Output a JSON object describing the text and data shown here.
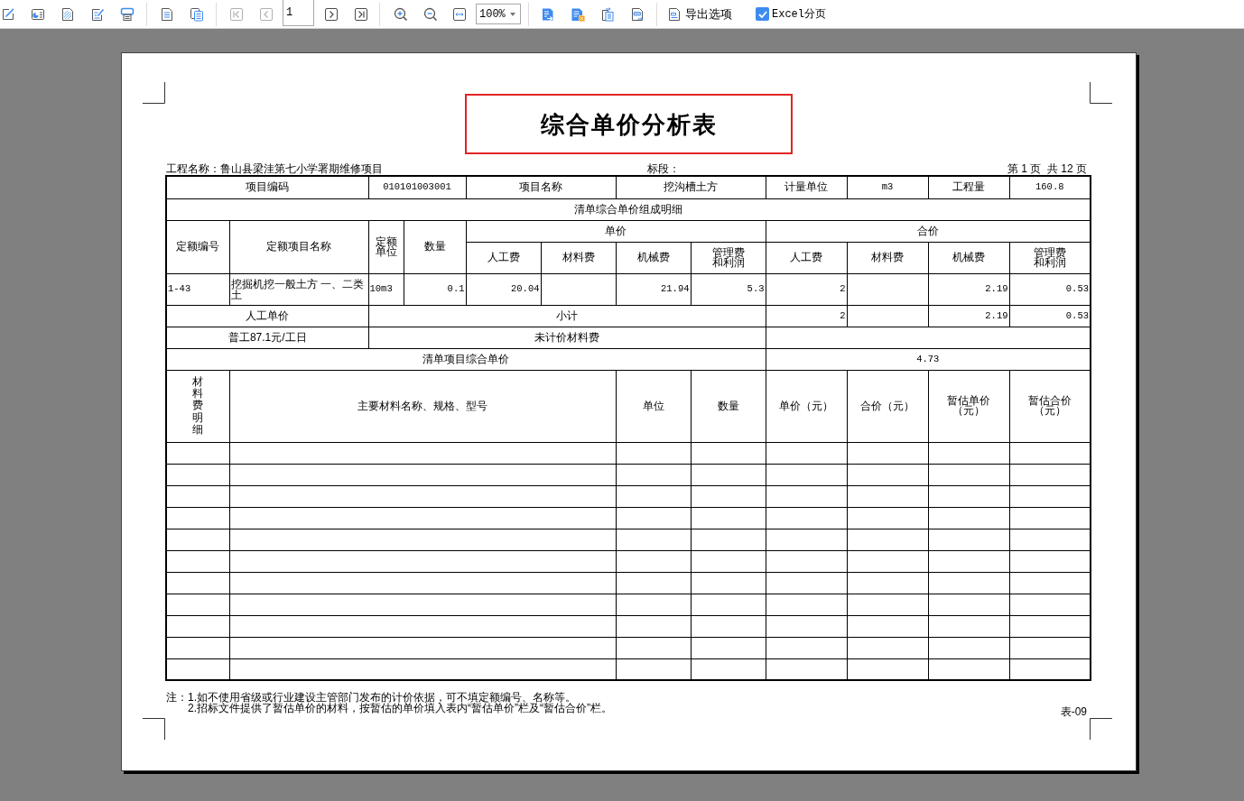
{
  "toolbar": {
    "page_nav": [
      {
        "disabled": true
      },
      {
        "disabled": true
      },
      {
        "disabled": false
      },
      {
        "disabled": false
      }
    ],
    "page_number": "1",
    "zoom": "100%",
    "export_options": "导出选项",
    "excel_paging": {
      "label": "Excel分页",
      "checked": true
    }
  },
  "document": {
    "title": "综合单价分析表",
    "project_name": "工程名称：鲁山县梁洼第七小学署期维修项目",
    "section": "标段：",
    "page_info": "第 1 页  共 12 页",
    "table": {
      "item": {
        "code_label": "项目编码",
        "code": "010101003001",
        "name_label": "项目名称",
        "name": "挖沟槽土方",
        "unit_label": "计量单位",
        "unit": "m3",
        "quantity_label": "工程量",
        "quantity": "160.8"
      },
      "composition_title": "清单综合单价组成明细",
      "quota_headers": {
        "code": "定额编号",
        "name": "定额项目名称",
        "unit": "定额单位",
        "quantity": "数量",
        "unit_price": "单价",
        "total_price": "合价"
      },
      "unit_price_columns": [
        "人工费",
        "材料费",
        "机械费",
        "管理费和利润"
      ],
      "total_price_columns": [
        "人工费",
        "材料费",
        "机械费",
        "管理费和利润"
      ],
      "quota_rows": [
        {
          "code": "1-43",
          "name": "挖掘机挖一般土方 一、二类土",
          "unit": "10m3",
          "quantity": "0.1",
          "unit_prices": {
            "labor": "20.04",
            "machinery": "21.94",
            "management_profit": "5.3"
          },
          "totals": {
            "labor": "2",
            "machinery": "2.19",
            "management_profit": "0.53"
          }
        }
      ],
      "labor_rate_label": "人工单价",
      "subtotal_label": "小计",
      "subtotal": {
        "labor": "2",
        "machinery": "2.19",
        "management_profit": "0.53"
      },
      "labor_rate": "普工87.1元/工日",
      "unpriced_material_label": "未计价材料费",
      "composite_price_label": "清单项目综合单价",
      "composite_price": "4.73",
      "material_section_label": "材料费明细",
      "material_columns": [
        "主要材料名称、规格、型号",
        "单位",
        "数量",
        "单价（元）",
        "合价（元）",
        "暂估单价（元）",
        "暂估合价（元）"
      ]
    },
    "notes": {
      "prefix": "注：",
      "items": [
        "1.如不使用省级或行业建设主管部门发布的计价依据，可不填定额编号、名称等。",
        "2.招标文件提供了暂估单价的材料，按暂估的单价填入表内“暂估单价”栏及“暂估合价”栏。"
      ]
    },
    "form_code": "表-09"
  }
}
